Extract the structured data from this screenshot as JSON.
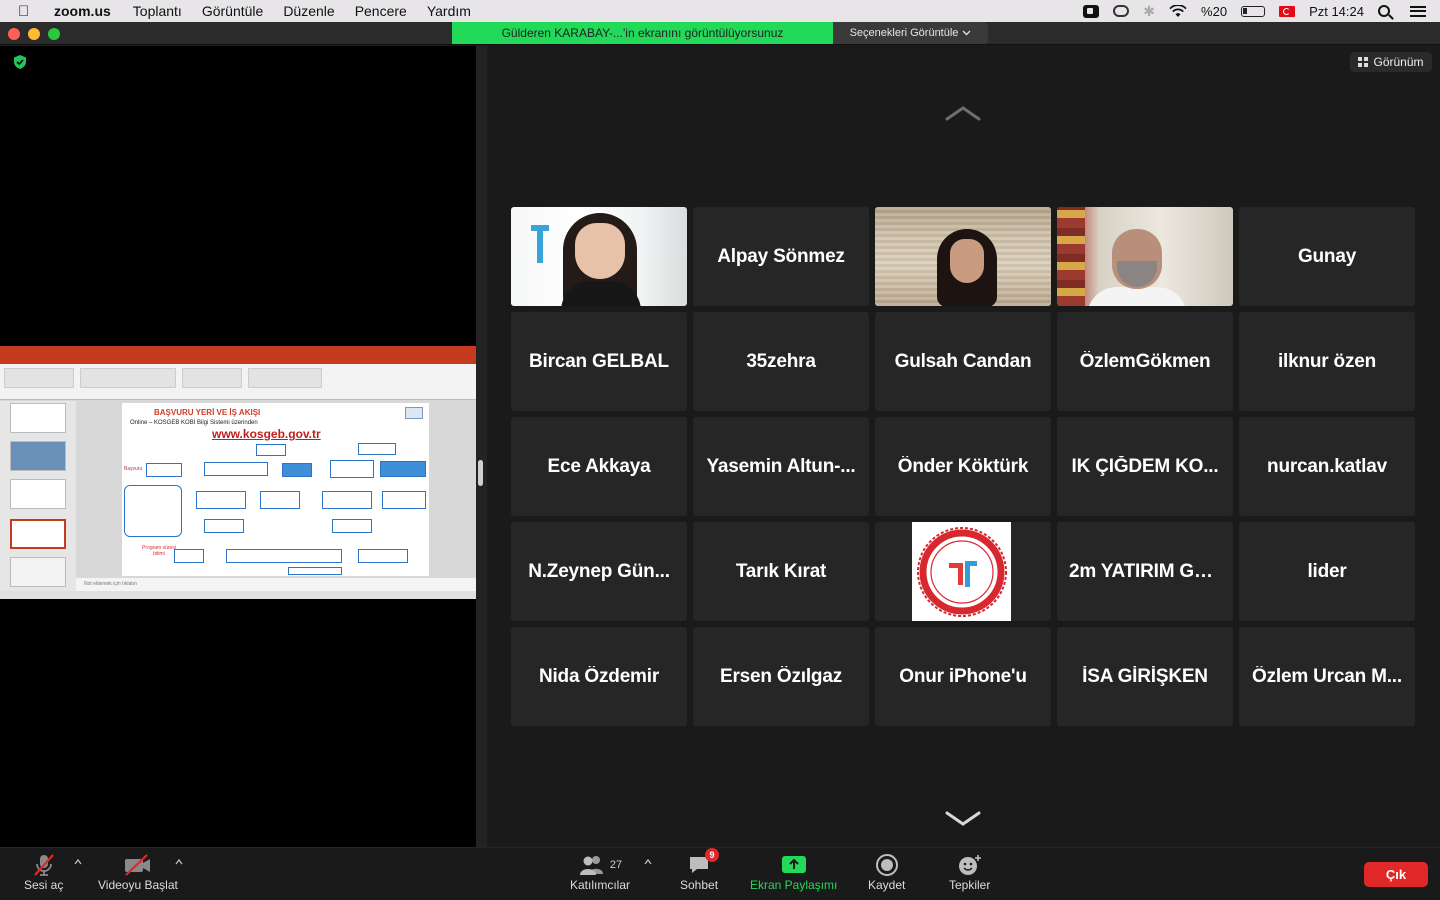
{
  "menubar": {
    "app": "zoom.us",
    "items": [
      "Toplantı",
      "Görüntüle",
      "Düzenle",
      "Pencere",
      "Yardım"
    ],
    "battery": "%20",
    "clock": "Pzt 14:24"
  },
  "window": {
    "share_banner": "Gülderen KARABAY-...'in ekranını görüntülüyorsunuz",
    "view_options": "Seçenekleri Görüntüle"
  },
  "slide": {
    "title": "BAŞVURU YERİ VE İŞ AKIŞI",
    "online": "Online – KOSGEB KOBİ Bilgi Sistemi üzerinden",
    "url": "www.kosgeb.gov.tr",
    "start": "Başvuru",
    "program_end": "Program süresi bitimi",
    "notes": "Not eklemek için tıklatın"
  },
  "gallery": {
    "view_button": "Görünüm",
    "tiles": [
      {
        "name": "",
        "video": "v1"
      },
      {
        "name": "Alpay Sönmez"
      },
      {
        "name": "",
        "video": "v3"
      },
      {
        "name": "",
        "video": "v4"
      },
      {
        "name": "Gunay"
      },
      {
        "name": "Bircan GELBAL"
      },
      {
        "name": "35zehra"
      },
      {
        "name": "Gulsah Candan"
      },
      {
        "name": "ÖzlemGökmen"
      },
      {
        "name": "ilknur özen"
      },
      {
        "name": "Ece Akkaya"
      },
      {
        "name": "Yasemin Altun-..."
      },
      {
        "name": "Önder Köktürk"
      },
      {
        "name": "IK ÇIĞDEM KO..."
      },
      {
        "name": "nurcan.katlav"
      },
      {
        "name": "N.Zeynep Gün..."
      },
      {
        "name": "Tarık Kırat"
      },
      {
        "name": "",
        "video": "seal"
      },
      {
        "name": "2m YATIRIM GA..."
      },
      {
        "name": "lider"
      },
      {
        "name": "Nida Özdemir"
      },
      {
        "name": "Ersen Özılgaz"
      },
      {
        "name": "Onur iPhone'u"
      },
      {
        "name": "İSA GİRİŞKEN"
      },
      {
        "name": "Özlem Urcan M..."
      }
    ]
  },
  "toolbar": {
    "unmute": "Sesi aç",
    "start_video": "Videoyu Başlat",
    "participants": "Katılımcılar",
    "participant_count": "27",
    "chat": "Sohbet",
    "chat_badge": "9",
    "share_screen": "Ekran Paylaşımı",
    "record": "Kaydet",
    "reactions": "Tepkiler",
    "exit": "Çık"
  },
  "colors": {
    "share_green": "#23d959",
    "exit_red": "#e02828",
    "active_speaker": "#2ed47a",
    "tile_bg": "#262626"
  }
}
